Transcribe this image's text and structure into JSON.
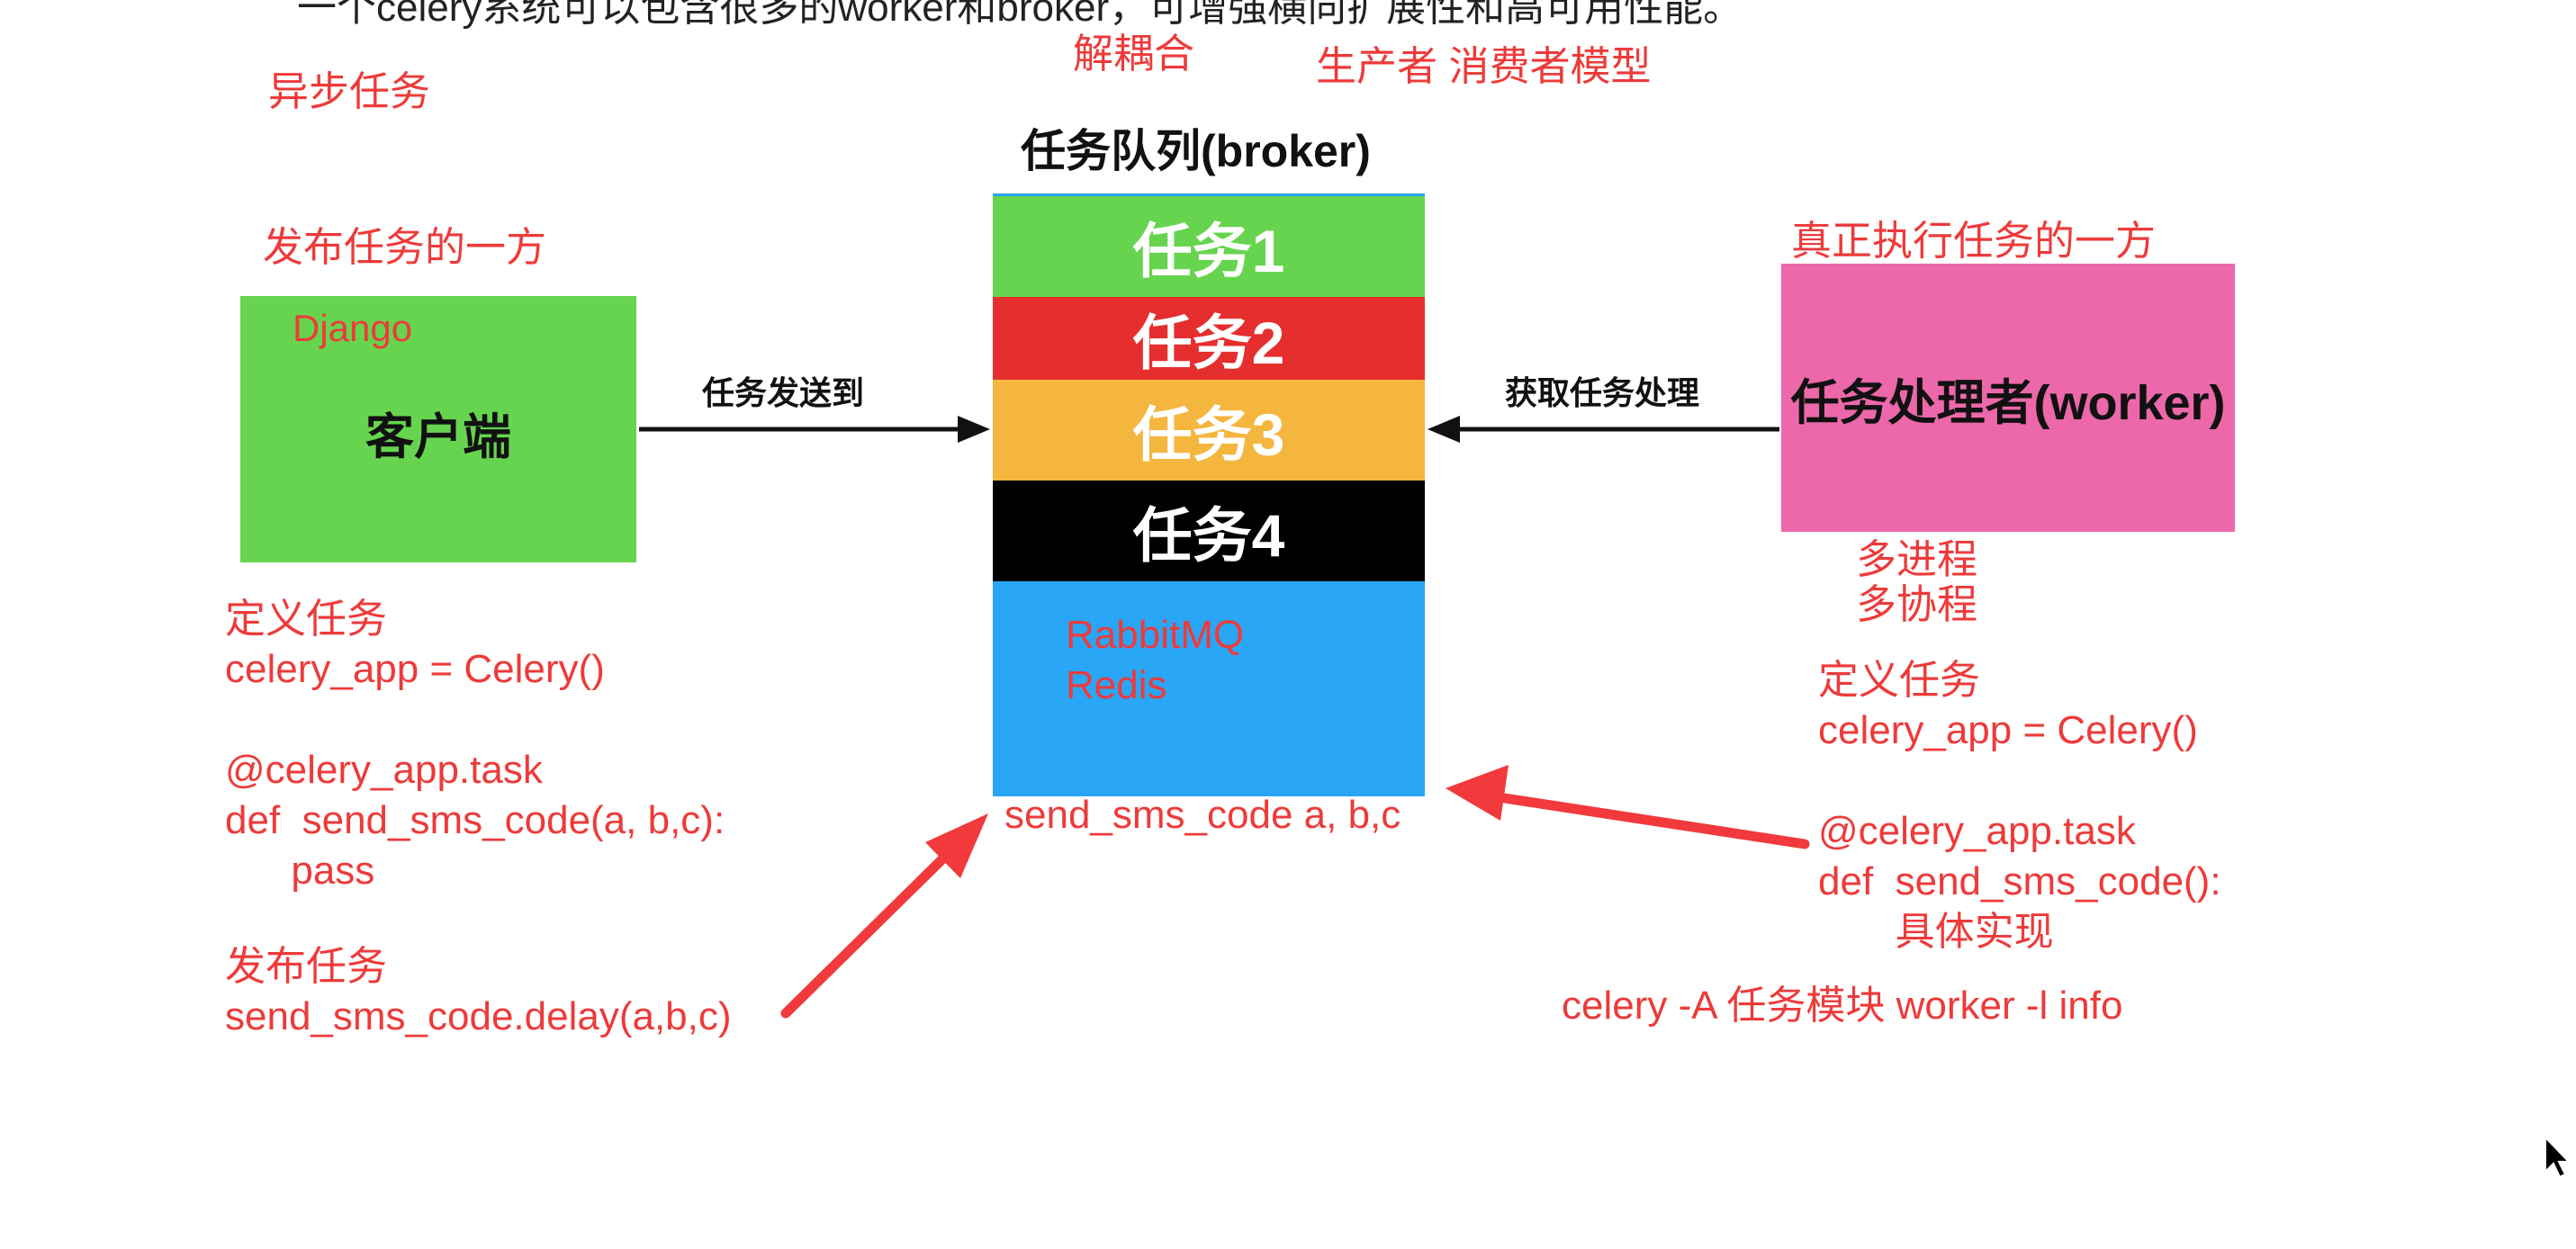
{
  "header_cutoff": "一个celery系统可以包含很多的worker和broker，可增强横向扩展性和高可用性能。",
  "notes": {
    "async": "异步任务",
    "decouple": "解耦合",
    "producer_consumer": "生产者 消费者模型",
    "publisher": "发布任务的一方",
    "executor": "真正执行任务的一方",
    "multi_process": "多进程",
    "multi_coroutine": "多协程"
  },
  "client": {
    "framework": "Django",
    "label": "客户端"
  },
  "broker": {
    "title": "任务队列(broker)",
    "tasks": [
      "任务1",
      "任务2",
      "任务3",
      "任务4"
    ],
    "backends": [
      "RabbitMQ",
      "Redis"
    ],
    "message": "send_sms_code   a, b,c"
  },
  "worker": {
    "label": "任务处理者(worker)"
  },
  "arrows": {
    "send_to": "任务发送到",
    "fetch_process": "获取任务处理"
  },
  "client_code": {
    "define_heading": "定义任务",
    "lines": [
      "celery_app = Celery()",
      "",
      "@celery_app.task",
      "def  send_sms_code(a, b,c):",
      "      pass"
    ],
    "publish_heading": "发布任务",
    "publish_call": "send_sms_code.delay(a,b,c)"
  },
  "worker_code": {
    "define_heading": "定义任务",
    "lines": [
      "celery_app = Celery()",
      "",
      "@celery_app.task",
      "def  send_sms_code():",
      "       具体实现"
    ],
    "command": "celery -A 任务模块 worker  -l info"
  },
  "colors": {
    "client_box": "#67d44f",
    "task1": "#67d44f",
    "task2": "#e52e2e",
    "task3": "#f5b63f",
    "task4": "#000000",
    "queue_base": "#2aa6f6",
    "worker_box": "#ec68aa",
    "annotation": "#ee3a3a"
  }
}
